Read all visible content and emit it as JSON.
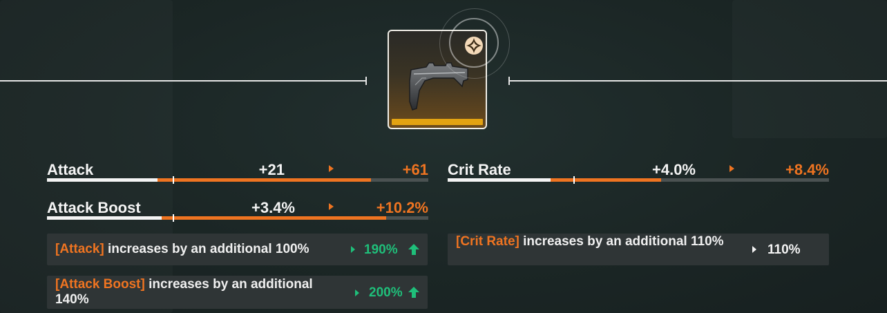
{
  "stats": [
    {
      "name": "Attack",
      "old": "+21",
      "new": "+61",
      "bar_white": 0.29,
      "bar_orange": 0.85,
      "marker": 0.33
    },
    {
      "name": "Crit Rate",
      "old": "+4.0%",
      "new": "+8.4%",
      "bar_white": 0.27,
      "bar_orange": 0.56,
      "marker": 0.33
    },
    {
      "name": "Attack Boost",
      "old": "+3.4%",
      "new": "+10.2%",
      "bar_white": 0.3,
      "bar_orange": 0.89,
      "marker": 0.33
    }
  ],
  "bonuses": [
    {
      "highlight": "[Attack]",
      "text": " increases by an additional 100%",
      "value": "190%",
      "boosted": true
    },
    {
      "highlight": "[Crit Rate]",
      "text": " increases by an additional 110%",
      "value": "110%",
      "boosted": false
    },
    {
      "highlight": "[Attack Boost]",
      "text": " increases by an additional 140%",
      "value": "200%",
      "boosted": true
    }
  ],
  "colors": {
    "accent": "#ef7421",
    "positive": "#1fbf7a",
    "rarity": "#e3a312"
  },
  "icons": {
    "item": "weapon-grip-icon",
    "badge": "four-point-star-icon",
    "increase": "up-arrow-icon"
  }
}
